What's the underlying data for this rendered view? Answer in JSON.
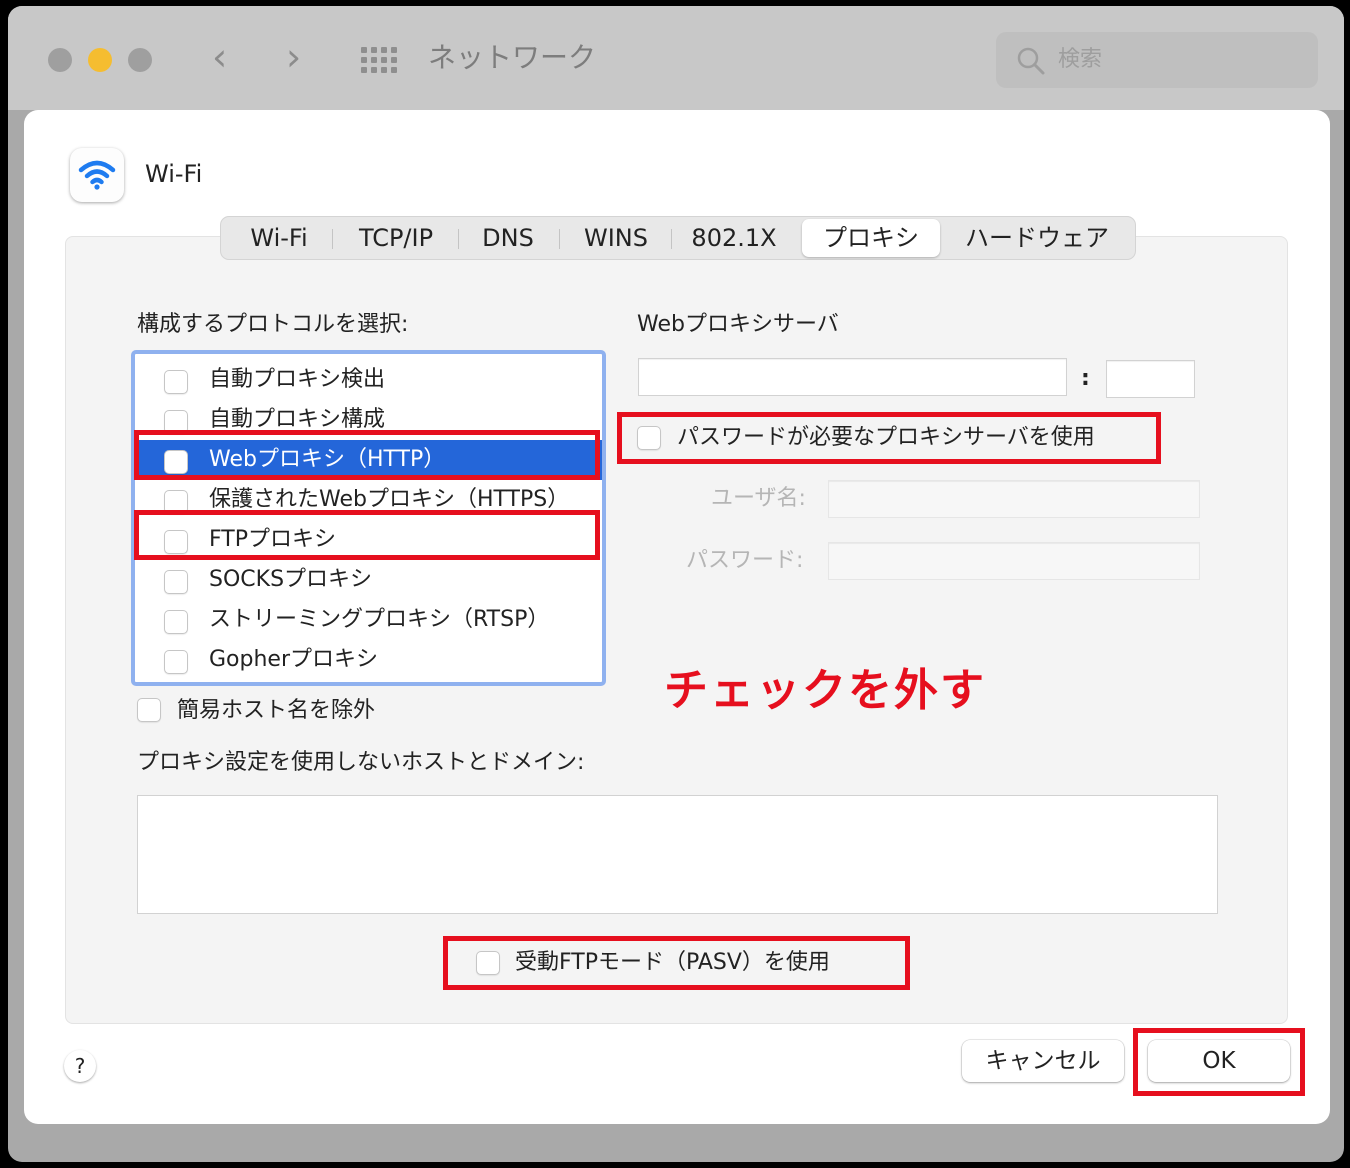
{
  "window": {
    "title": "ネットワーク",
    "nav_back": "‹",
    "nav_forward": "›"
  },
  "search": {
    "placeholder": "検索"
  },
  "interface": {
    "name": "Wi-Fi"
  },
  "tabs": [
    {
      "label": "Wi-Fi",
      "selected": false
    },
    {
      "label": "TCP/IP",
      "selected": false
    },
    {
      "label": "DNS",
      "selected": false
    },
    {
      "label": "WINS",
      "selected": false
    },
    {
      "label": "802.1X",
      "selected": false
    },
    {
      "label": "プロキシ",
      "selected": true
    },
    {
      "label": "ハードウェア",
      "selected": false
    }
  ],
  "protocols": {
    "heading": "構成するプロトコルを選択:",
    "items": [
      {
        "label": "自動プロキシ検出",
        "checked": false,
        "selected": false
      },
      {
        "label": "自動プロキシ構成",
        "checked": false,
        "selected": false
      },
      {
        "label": "Webプロキシ（HTTP）",
        "checked": false,
        "selected": true
      },
      {
        "label": "保護されたWebプロキシ（HTTPS）",
        "checked": false,
        "selected": false
      },
      {
        "label": "FTPプロキシ",
        "checked": false,
        "selected": false
      },
      {
        "label": "SOCKSプロキシ",
        "checked": false,
        "selected": false
      },
      {
        "label": "ストリーミングプロキシ（RTSP）",
        "checked": false,
        "selected": false
      },
      {
        "label": "Gopherプロキシ",
        "checked": false,
        "selected": false
      }
    ]
  },
  "server": {
    "heading": "Webプロキシサーバ",
    "host_value": "",
    "port_separator": ":",
    "port_value": "",
    "require_password_label": "パスワードが必要なプロキシサーバを使用",
    "require_password_checked": false,
    "username_label": "ユーザ名:",
    "username_value": "",
    "password_label": "パスワード:",
    "password_value": ""
  },
  "exclude_simple_hostnames": {
    "label": "簡易ホスト名を除外",
    "checked": false
  },
  "bypass": {
    "label": "プロキシ設定を使用しないホストとドメイン:",
    "value": ""
  },
  "passive_ftp": {
    "label": "受動FTPモード（PASV）を使用",
    "checked": false
  },
  "buttons": {
    "help": "?",
    "cancel": "キャンセル",
    "ok": "OK"
  },
  "annotation": {
    "text": "チェックを外す",
    "color": "#e60f1e"
  },
  "colors": {
    "selection": "#2466d9",
    "focus_ring": "#8fb1ef",
    "wifi_icon": "#1f7cf0",
    "traffic_yellow": "#f5bd30"
  }
}
